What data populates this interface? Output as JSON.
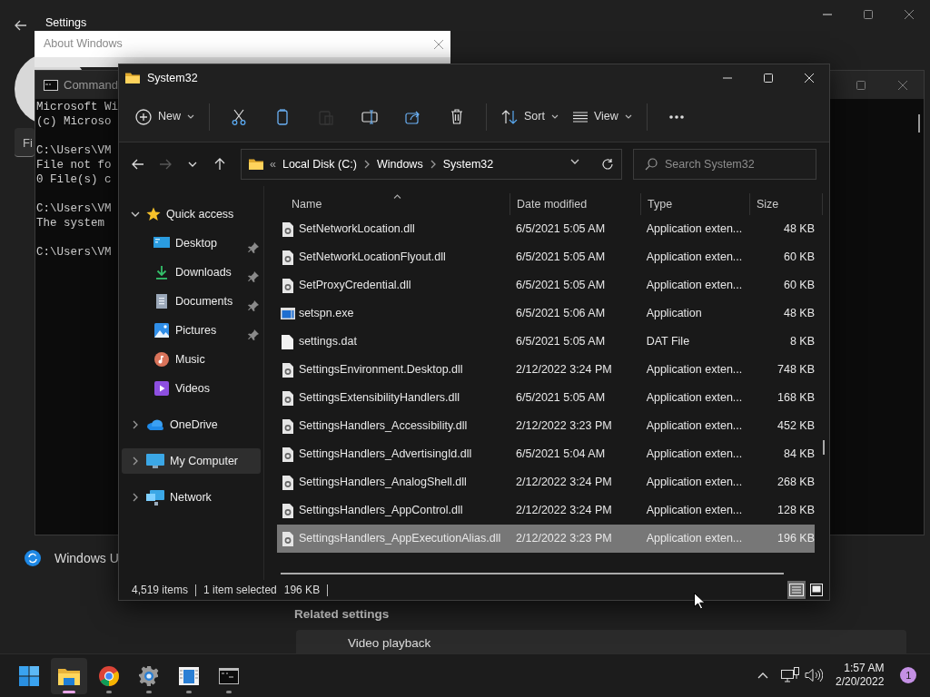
{
  "settings_window": {
    "title": "Settings",
    "search_placeholder": "Fi",
    "nav_item": "Windows U",
    "related_heading": "Related settings",
    "related_items": [
      "Video playback"
    ]
  },
  "about_dialog": {
    "title": "About Windows"
  },
  "console_window": {
    "title": "Command",
    "blocks": [
      [
        "Microsoft Wi",
        "(c) Microso"
      ],
      [
        "C:\\Users\\VM",
        "File not fo",
        "0 File(s) c"
      ],
      [
        "C:\\Users\\VM",
        "The system"
      ],
      [
        "C:\\Users\\VM"
      ]
    ]
  },
  "explorer": {
    "title": "System32",
    "toolbar": [
      {
        "kind": "new",
        "label": "New",
        "disabled": false
      },
      {
        "kind": "separator"
      },
      {
        "kind": "cut",
        "disabled": false
      },
      {
        "kind": "copy",
        "disabled": false
      },
      {
        "kind": "paste",
        "disabled": true
      },
      {
        "kind": "rename",
        "disabled": false
      },
      {
        "kind": "share",
        "disabled": false
      },
      {
        "kind": "delete",
        "disabled": false
      },
      {
        "kind": "separator"
      },
      {
        "kind": "sort",
        "label": "Sort",
        "disabled": false
      },
      {
        "kind": "view",
        "label": "View",
        "disabled": false
      },
      {
        "kind": "separator"
      },
      {
        "kind": "more",
        "disabled": false
      }
    ],
    "nav_buttons": [
      {
        "kind": "back",
        "disabled": false
      },
      {
        "kind": "forward",
        "disabled": true
      },
      {
        "kind": "recent",
        "disabled": false
      },
      {
        "kind": "up",
        "disabled": false
      }
    ],
    "address": {
      "overflow_mark": "«",
      "crumbs": [
        "Local Disk (C:)",
        "Windows",
        "System32"
      ]
    },
    "search": {
      "placeholder": "Search System32"
    },
    "nav_pane": [
      {
        "kind": "star",
        "label": "Quick access",
        "expanded": true,
        "selected": false,
        "children": [
          {
            "kind": "desktop",
            "label": "Desktop",
            "pinned": true,
            "selected": false
          },
          {
            "kind": "downloads",
            "label": "Downloads",
            "pinned": true,
            "selected": false
          },
          {
            "kind": "documents",
            "label": "Documents",
            "pinned": true,
            "selected": false
          },
          {
            "kind": "pictures",
            "label": "Pictures",
            "pinned": true,
            "selected": false
          },
          {
            "kind": "music",
            "label": "Music",
            "pinned": false,
            "selected": false
          },
          {
            "kind": "videos",
            "label": "Videos",
            "pinned": false,
            "selected": false
          }
        ]
      },
      {
        "kind": "cloud",
        "label": "OneDrive",
        "expanded": false,
        "selected": false
      },
      {
        "kind": "computer",
        "label": "My Computer",
        "expanded": false,
        "selected": true
      },
      {
        "kind": "network",
        "label": "Network",
        "expanded": false,
        "selected": false
      }
    ],
    "columns": [
      {
        "label": "Name",
        "sorted": true
      },
      {
        "label": "Date modified",
        "sorted": false
      },
      {
        "label": "Type",
        "sorted": false
      },
      {
        "label": "Size",
        "sorted": false
      }
    ],
    "rows": [
      {
        "kind": "dll",
        "name": "SetNetworkLocation.dll",
        "date": "6/5/2021 5:05 AM",
        "type": "Application exten...",
        "size": "48 KB",
        "selected": false
      },
      {
        "kind": "dll",
        "name": "SetNetworkLocationFlyout.dll",
        "date": "6/5/2021 5:05 AM",
        "type": "Application exten...",
        "size": "60 KB",
        "selected": false
      },
      {
        "kind": "dll",
        "name": "SetProxyCredential.dll",
        "date": "6/5/2021 5:05 AM",
        "type": "Application exten...",
        "size": "60 KB",
        "selected": false
      },
      {
        "kind": "exe",
        "name": "setspn.exe",
        "date": "6/5/2021 5:06 AM",
        "type": "Application",
        "size": "48 KB",
        "selected": false
      },
      {
        "kind": "dat",
        "name": "settings.dat",
        "date": "6/5/2021 5:05 AM",
        "type": "DAT File",
        "size": "8 KB",
        "selected": false
      },
      {
        "kind": "dll",
        "name": "SettingsEnvironment.Desktop.dll",
        "date": "2/12/2022 3:24 PM",
        "type": "Application exten...",
        "size": "748 KB",
        "selected": false
      },
      {
        "kind": "dll",
        "name": "SettingsExtensibilityHandlers.dll",
        "date": "6/5/2021 5:05 AM",
        "type": "Application exten...",
        "size": "168 KB",
        "selected": false
      },
      {
        "kind": "dll",
        "name": "SettingsHandlers_Accessibility.dll",
        "date": "2/12/2022 3:23 PM",
        "type": "Application exten...",
        "size": "452 KB",
        "selected": false
      },
      {
        "kind": "dll",
        "name": "SettingsHandlers_AdvertisingId.dll",
        "date": "6/5/2021 5:04 AM",
        "type": "Application exten...",
        "size": "84 KB",
        "selected": false
      },
      {
        "kind": "dll",
        "name": "SettingsHandlers_AnalogShell.dll",
        "date": "2/12/2022 3:24 PM",
        "type": "Application exten...",
        "size": "268 KB",
        "selected": false
      },
      {
        "kind": "dll",
        "name": "SettingsHandlers_AppControl.dll",
        "date": "2/12/2022 3:24 PM",
        "type": "Application exten...",
        "size": "128 KB",
        "selected": false
      },
      {
        "kind": "dll",
        "name": "SettingsHandlers_AppExecutionAlias.dll",
        "date": "2/12/2022 3:23 PM",
        "type": "Application exten...",
        "size": "196 KB",
        "selected": true
      }
    ],
    "status": {
      "count": "4,519 items",
      "selection": "1 item selected",
      "size": "196 KB"
    },
    "view_modes": [
      {
        "kind": "details",
        "selected": true
      },
      {
        "kind": "tiles",
        "selected": false
      }
    ]
  },
  "taskbar": {
    "apps": [
      {
        "kind": "start",
        "running": false,
        "active": false
      },
      {
        "kind": "explorer",
        "running": true,
        "active": true
      },
      {
        "kind": "chrome",
        "running": true,
        "active": false
      },
      {
        "kind": "settings",
        "running": true,
        "active": false
      },
      {
        "kind": "notepad",
        "running": true,
        "active": false
      },
      {
        "kind": "console",
        "running": true,
        "active": false
      }
    ],
    "tray": {
      "time": "1:57 AM",
      "date": "2/20/2022",
      "badge": "1"
    }
  }
}
